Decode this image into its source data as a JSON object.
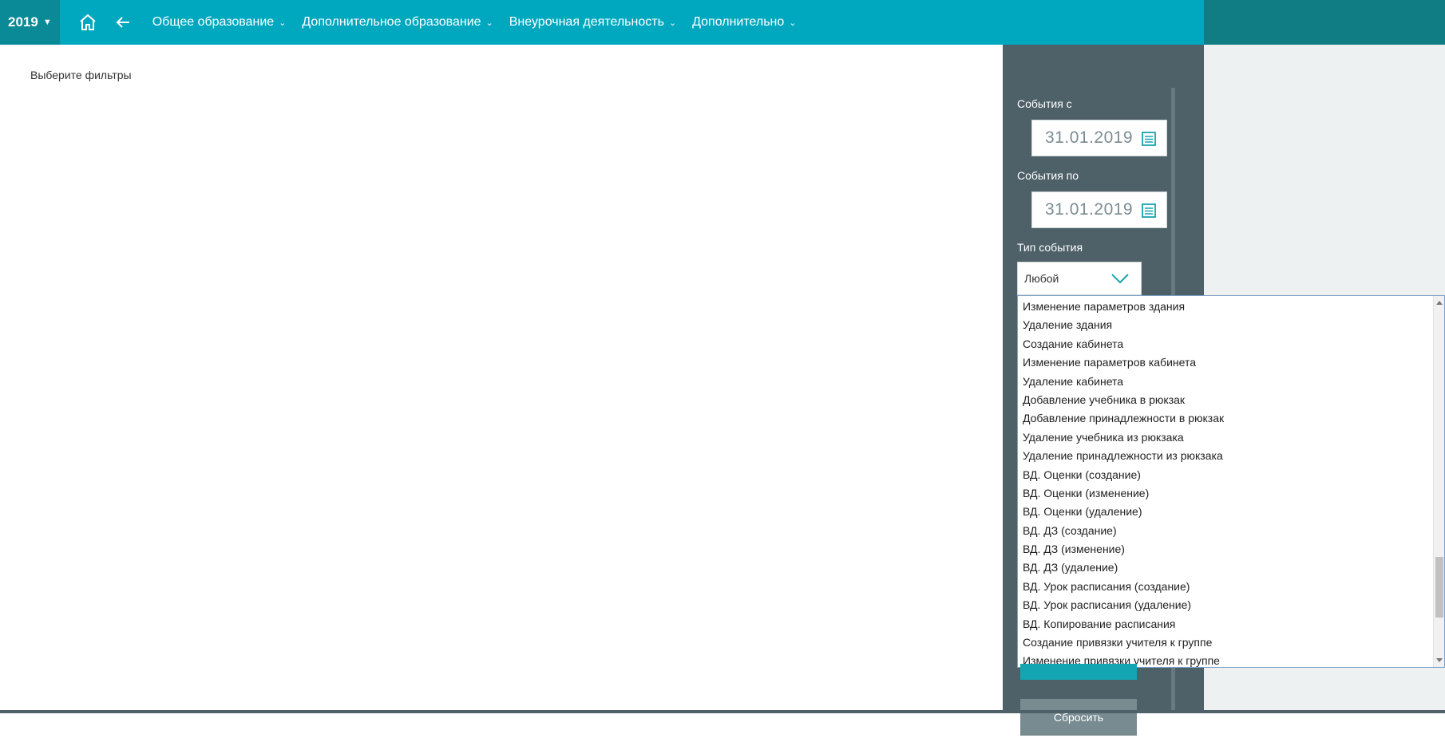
{
  "header": {
    "year": "2019",
    "menu": [
      {
        "label": "Общее образование"
      },
      {
        "label": "Дополнительное образование"
      },
      {
        "label": "Внеурочная деятельность"
      },
      {
        "label": "Дополнительно"
      }
    ]
  },
  "content": {
    "hint": "Выберите фильтры"
  },
  "filters": {
    "from_label": "События с",
    "from_value": "31.01.2019",
    "to_label": "События по",
    "to_value": "31.01.2019",
    "type_label": "Тип события",
    "type_value": "Любой",
    "reset_label": "Сбросить",
    "options": [
      "Изменение параметров здания",
      "Удаление здания",
      "Создание кабинета",
      "Изменение параметров кабинета",
      "Удаление кабинета",
      "Добавление учебника в рюкзак",
      "Добавление принадлежности в рюкзак",
      "Удаление учебника из рюкзака",
      "Удаление принадлежности из рюкзака",
      "ВД. Оценки (создание)",
      "ВД. Оценки (изменение)",
      "ВД. Оценки (удаление)",
      "ВД. ДЗ (создание)",
      "ВД. ДЗ (изменение)",
      "ВД. ДЗ (удаление)",
      "ВД. Урок расписания (создание)",
      "ВД. Урок расписания (удаление)",
      "ВД. Копирование расписания",
      "Создание привязки учителя к группе",
      "Изменение привязки учителя к группе"
    ]
  },
  "colors": {
    "header_bg": "#00a8bf",
    "sidebar_bg": "#4f6168",
    "accent": "#13a6b2"
  }
}
